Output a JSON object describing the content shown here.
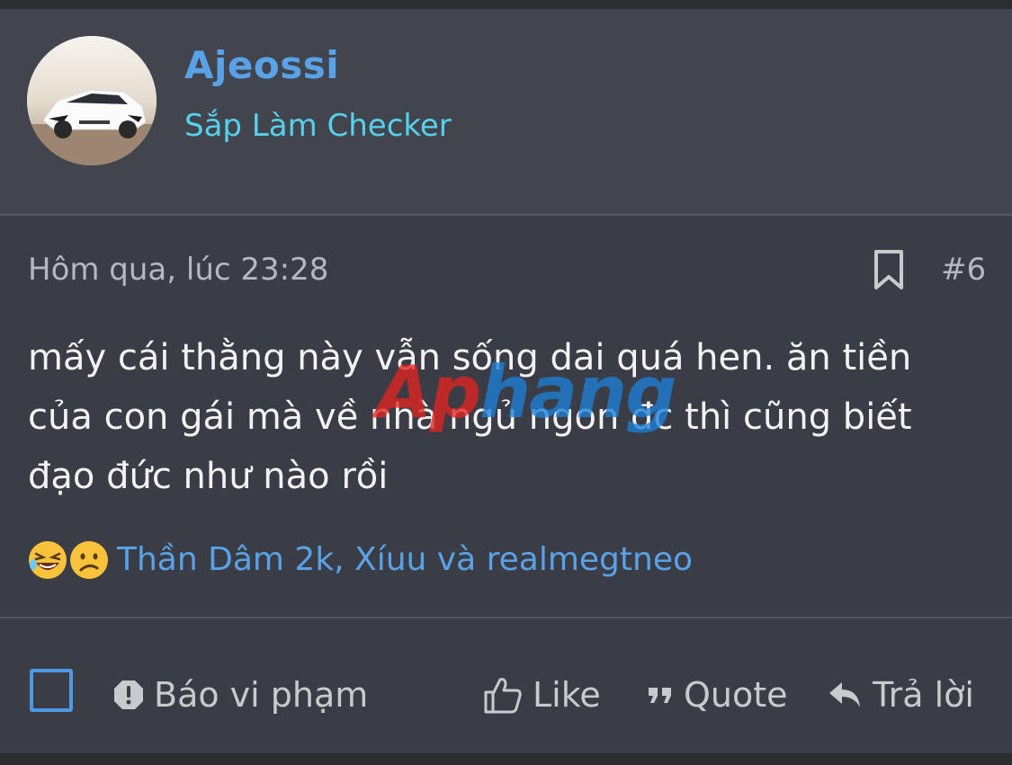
{
  "user": {
    "name": "Ajeossi",
    "title": "Sắp Làm Checker"
  },
  "post": {
    "time": "Hôm qua, lúc 23:28",
    "number": "#6",
    "message": "mấy cái thằng này vẫn sống dai quá hen. ăn tiền của con gái mà về nhà ngủ ngon đc thì cũng biết đạo đức như nào rồi",
    "watermark": {
      "part1": "Ap",
      "part2": "hang"
    }
  },
  "reactions": {
    "icons": [
      "laughing-emoji",
      "sad-emoji"
    ],
    "users": "Thần Dâm 2k, Xíuu và realmegtneo"
  },
  "actions": {
    "report": "Báo vi phạm",
    "like": "Like",
    "quote": "Quote",
    "reply": "Trả lời"
  },
  "colors": {
    "username": "#5aa2e8",
    "user_title": "#56d1ec",
    "link": "#5aa2e8",
    "background": "#3a3d45"
  }
}
